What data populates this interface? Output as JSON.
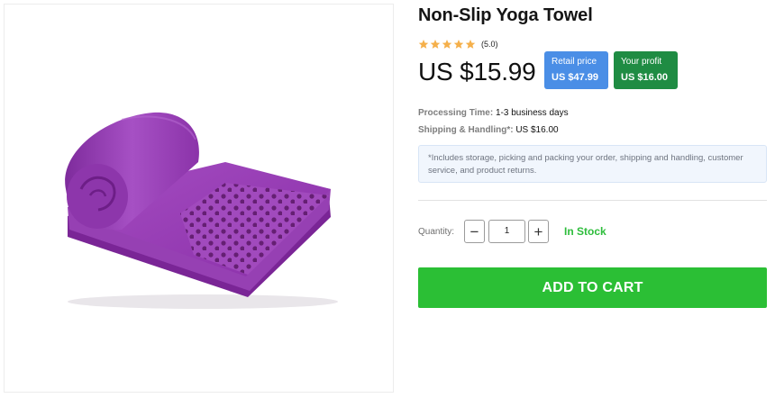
{
  "product": {
    "title": "Non-Slip Yoga Towel",
    "image_icon": "purple-rolled-yoga-towel",
    "rating": {
      "stars": 5,
      "max": 5,
      "text": "(5.0)",
      "color": "#f5b04b"
    },
    "price": "US $15.99",
    "retail": {
      "label": "Retail price",
      "value": "US $47.99",
      "color": "#4a8ee6"
    },
    "profit": {
      "label": "Your profit",
      "value": "US $16.00",
      "color": "#1f8c43"
    },
    "processing": {
      "label": "Processing Time:",
      "value": "1-3 business days"
    },
    "shipping": {
      "label": "Shipping & Handling*:",
      "value": "US $16.00"
    },
    "notice": "*Includes storage, picking and packing your order, shipping and handling, customer service, and product returns.",
    "quantity": {
      "label": "Quantity:",
      "value": "1",
      "minus": "−",
      "plus": "+"
    },
    "stock": "In Stock",
    "cart_button": "ADD TO CART",
    "accent_green": "#2bbf35"
  }
}
